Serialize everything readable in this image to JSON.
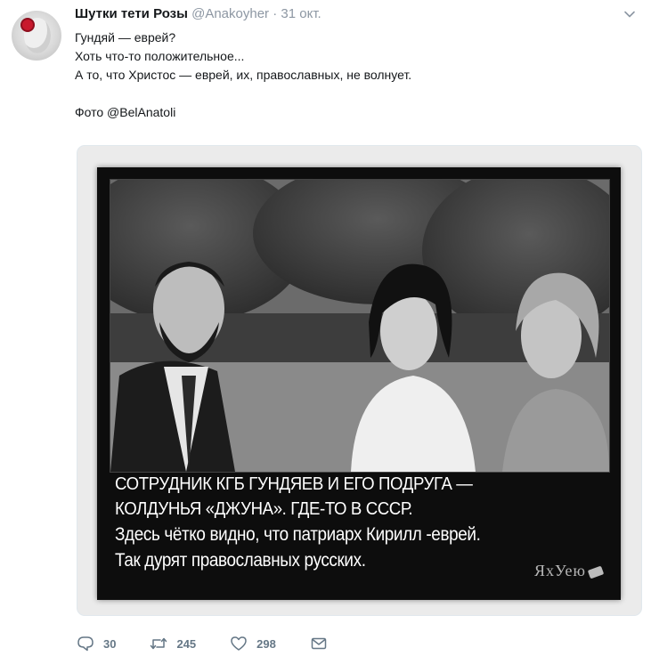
{
  "tweet": {
    "author_name": "Шутки тети Розы",
    "author_handle": "@Anakoyher",
    "separator": "·",
    "timestamp": "31 окт.",
    "lines": [
      "Гундяй — еврей?",
      "Хоть что-то положительное...",
      "А то, что Христос — еврей, их, православных, не волнует.",
      "",
      "Фото @BelAnatoli"
    ]
  },
  "image": {
    "caption": [
      "СОТРУДНИК КГБ ГУНДЯЕВ И ЕГО ПОДРУГА —",
      "КОЛДУНЬЯ «ДЖУНА». ГДЕ-ТО В СССР.",
      "Здесь чётко видно, что патриарх Кирилл -еврей.",
      "Так дурят православных русских."
    ],
    "watermark": "ЯхУею"
  },
  "actions": {
    "reply_count": "30",
    "retweet_count": "245",
    "like_count": "298"
  },
  "icons": [
    "avatar",
    "chevron-down-icon",
    "reply-icon",
    "retweet-icon",
    "like-icon",
    "message-icon"
  ],
  "colors": {
    "muted": "#657786",
    "text": "#14171a",
    "border": "#e1e8ed"
  }
}
